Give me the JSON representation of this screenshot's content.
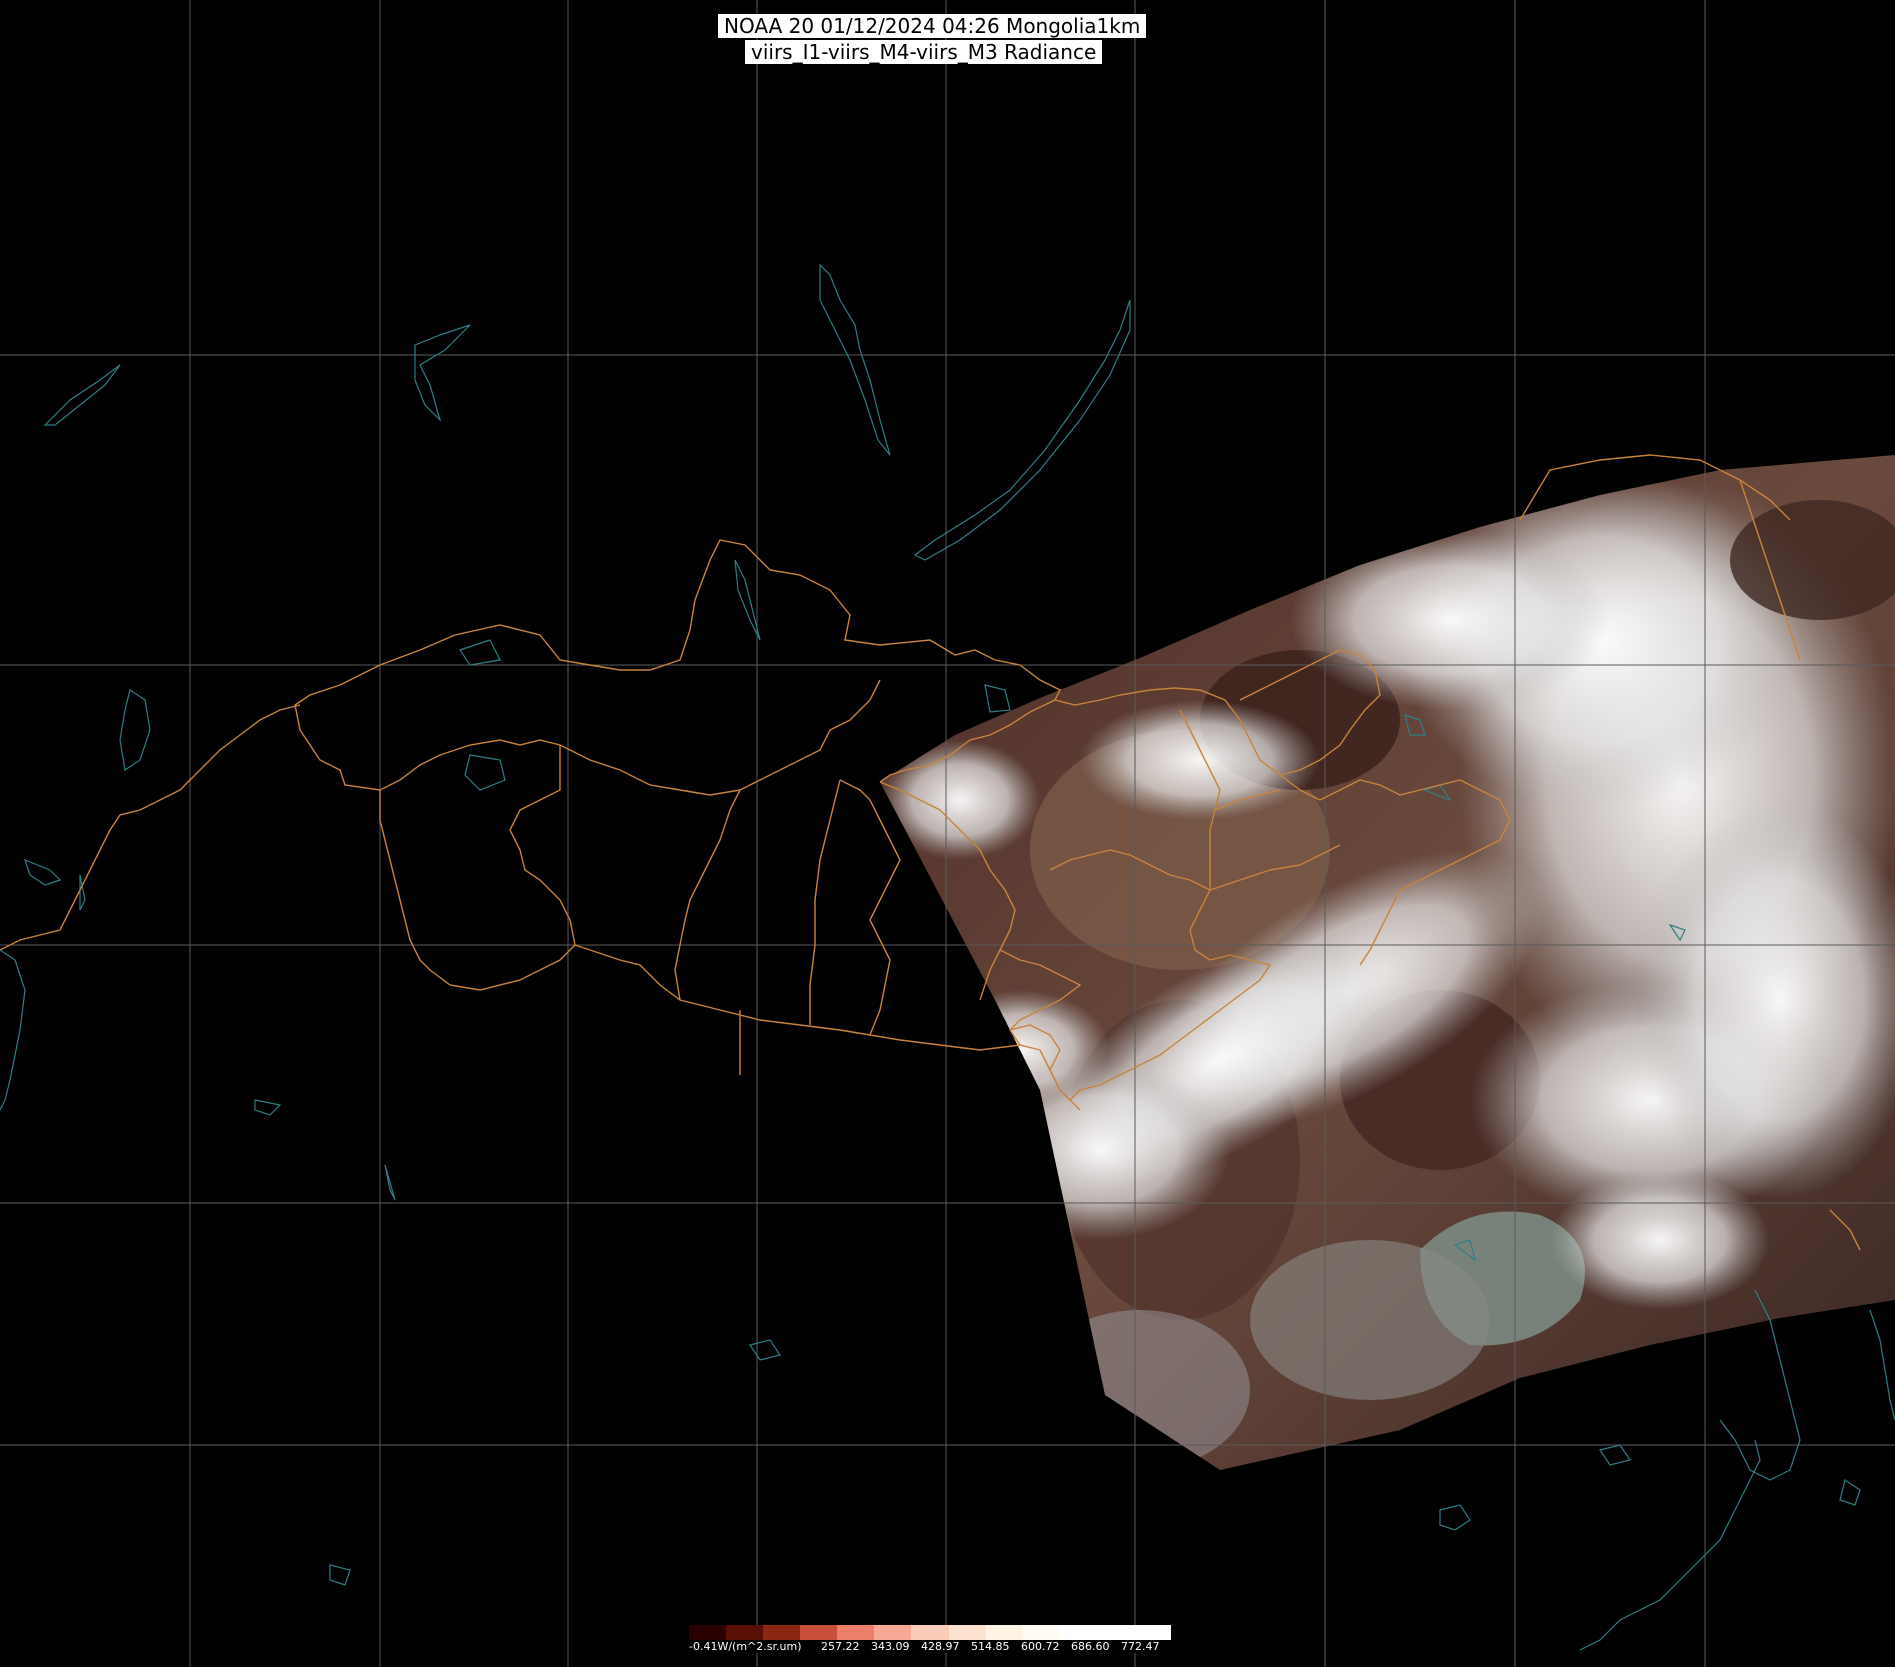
{
  "title": {
    "line1": "NOAA 20 01/12/2024 04:26 Mongolia1km",
    "line2": "viirs_I1-viirs_M4-viirs_M3 Radiance"
  },
  "colorbar": {
    "labels": [
      "-0.41W/(m^2.sr.um)",
      "257.22",
      "343.09",
      "428.97",
      "514.85",
      "600.72",
      "686.60",
      "772.47"
    ],
    "colors": [
      "#2a0000",
      "#5a0f05",
      "#8c2812",
      "#c8503a",
      "#ec7f6a",
      "#f7a896",
      "#fbcdb8",
      "#fde3cf",
      "#fff3e6",
      "#fffaf4",
      "#ffffff",
      "#ffffff",
      "#ffffff"
    ]
  },
  "style": {
    "grid_color": "#5a5a5a",
    "border_color": "#c8843c",
    "coast_color": "#2f7f86",
    "cloud_color": "#f2f2f2",
    "land_color": "#5a3a32"
  }
}
